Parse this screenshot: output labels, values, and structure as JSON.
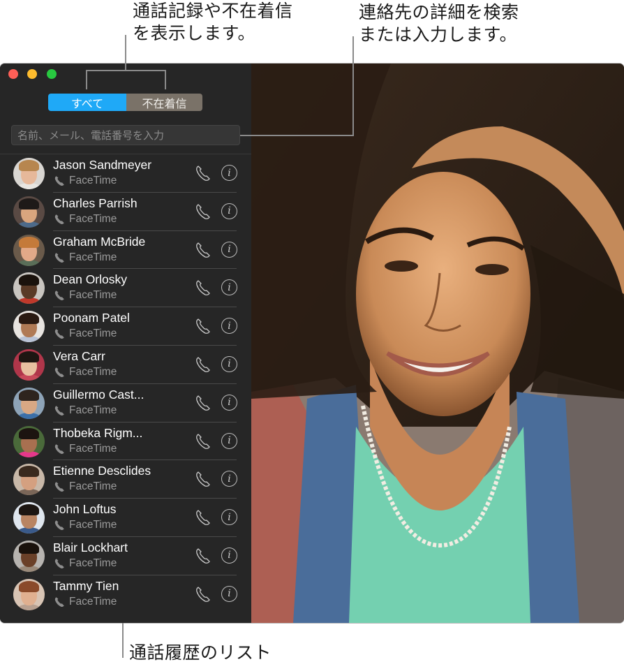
{
  "callouts": {
    "top_left_line1": "通話記録や不在着信",
    "top_left_line2": "を表示します。",
    "top_right_line1": "連絡先の詳細を検索",
    "top_right_line2": "または入力します。",
    "bottom": "通話履歴のリスト"
  },
  "window": {
    "traffic_lights": [
      "close",
      "minimize",
      "maximize"
    ],
    "segmented_control": {
      "options": [
        "すべて",
        "不在着信"
      ],
      "selected": "すべて",
      "selected_color": "#1fa9f7"
    },
    "search": {
      "placeholder": "名前、メール、電話番号を入力",
      "value": ""
    },
    "call_list": [
      {
        "name": "Jason Sandmeyer",
        "type": "FaceTime"
      },
      {
        "name": "Charles Parrish",
        "type": "FaceTime"
      },
      {
        "name": "Graham McBride",
        "type": "FaceTime"
      },
      {
        "name": "Dean Orlosky",
        "type": "FaceTime"
      },
      {
        "name": "Poonam Patel",
        "type": "FaceTime"
      },
      {
        "name": "Vera Carr",
        "type": "FaceTime"
      },
      {
        "name": "Guillermo Cast...",
        "type": "FaceTime"
      },
      {
        "name": "Thobeka Rigm...",
        "type": "FaceTime"
      },
      {
        "name": "Etienne Desclides",
        "type": "FaceTime"
      },
      {
        "name": "John Loftus",
        "type": "FaceTime"
      },
      {
        "name": "Blair Lockhart",
        "type": "FaceTime"
      },
      {
        "name": "Tammy Tien",
        "type": "FaceTime"
      }
    ],
    "icons": {
      "call": "phone-icon",
      "info": "info-icon",
      "info_glyph": "i"
    }
  }
}
